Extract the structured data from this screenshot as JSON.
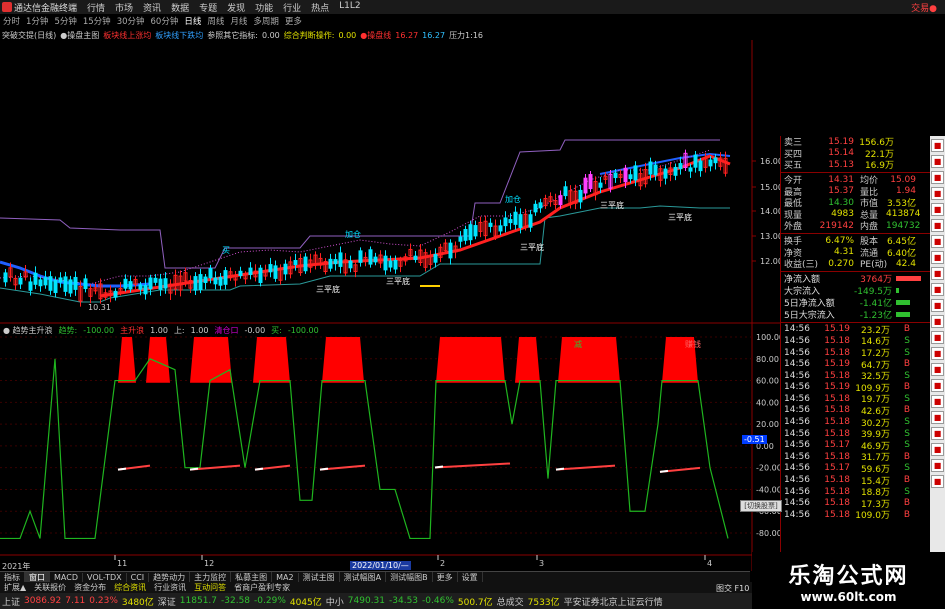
{
  "title_bar": {
    "app_name": "通达信金融终端",
    "menu": [
      "行情",
      "市场",
      "资讯",
      "数据",
      "专题",
      "发现",
      "功能",
      "行业",
      "热点",
      "L1L2"
    ],
    "trade_button": "交易●"
  },
  "period_bar": {
    "items": [
      "分时",
      "1分钟",
      "5分钟",
      "15分钟",
      "30分钟",
      "60分钟",
      "日线",
      "周线",
      "月线",
      "多周期",
      "更多"
    ],
    "active": "日线"
  },
  "indicator_bar": {
    "items": [
      {
        "text": "突破交提(日线)",
        "color": "#cccccc"
      },
      {
        "text": "●操盘主图",
        "color": "#cccccc"
      },
      {
        "text": "板块线上涨均",
        "color": "#ff3030"
      },
      {
        "text": "板块线下跌均",
        "color": "#30a0ff"
      },
      {
        "text": "参照其它指标:",
        "color": "#cccccc"
      },
      {
        "text": "0.00",
        "color": "#cccccc"
      },
      {
        "text": "综合判断操作:",
        "color": "#e0e000"
      },
      {
        "text": "0.00",
        "color": "#e0e000"
      },
      {
        "text": "●操盘线",
        "color": "#ff3030"
      },
      {
        "text": "16.27",
        "color": "#ff3030"
      },
      {
        "text": "16.27",
        "color": "#30c0ff"
      },
      {
        "text": "压力1:16",
        "color": "#cccccc"
      }
    ]
  },
  "lower_legend": {
    "items": [
      {
        "text": "● 趋势主升浪",
        "color": "#cccccc"
      },
      {
        "text": "趋势:",
        "color": "#30c030"
      },
      {
        "text": "-100.00",
        "color": "#30c030"
      },
      {
        "text": "主升浪",
        "color": "#ff3030"
      },
      {
        "text": "1.00",
        "color": "#cccccc"
      },
      {
        "text": "上:",
        "color": "#cccccc"
      },
      {
        "text": "1.00",
        "color": "#cccccc"
      },
      {
        "text": "清仓口",
        "color": "#cc00cc"
      },
      {
        "text": "-0.00",
        "color": "#cccccc"
      },
      {
        "text": "买:",
        "color": "#30c030"
      },
      {
        "text": "-100.00",
        "color": "#30c030"
      }
    ]
  },
  "quote_panel": {
    "levels": [
      {
        "label": "卖三",
        "price": "15.19",
        "vol": "156.6万",
        "flag": ""
      },
      {
        "label": "买四",
        "price": "15.14",
        "vol": "22.1万",
        "flag": ""
      },
      {
        "label": "买五",
        "price": "15.13",
        "vol": "16.9万",
        "flag": ""
      }
    ],
    "stats": [
      {
        "l1": "今开",
        "v1": "14.31",
        "l2": "均价",
        "v2": "15.09",
        "c1": "#ff4040",
        "c2": "#ff4040"
      },
      {
        "l1": "最高",
        "v1": "15.37",
        "l2": "量比",
        "v2": "1.94",
        "c1": "#ff4040",
        "c2": "#ff4040"
      },
      {
        "l1": "最低",
        "v1": "14.30",
        "l2": "市值",
        "v2": "3.53亿",
        "c1": "#30c030",
        "c2": "#e0e000"
      },
      {
        "l1": "现量",
        "v1": "4983",
        "l2": "总量",
        "v2": "413874",
        "c1": "#e0e000",
        "c2": "#e0e000"
      },
      {
        "l1": "外盘",
        "v1": "219142",
        "l2": "内盘",
        "v2": "194732",
        "c1": "#ff4040",
        "c2": "#30c030"
      }
    ],
    "stats2": [
      {
        "l1": "换手",
        "v1": "6.47%",
        "l2": "股本",
        "v2": "6.45亿",
        "c1": "#e0e000",
        "c2": "#e0e000"
      },
      {
        "l1": "净资",
        "v1": "4.31",
        "l2": "流通",
        "v2": "6.40亿",
        "c1": "#e0e000",
        "c2": "#e0e000"
      },
      {
        "l1": "收益(三)",
        "v1": "0.270",
        "l2": "PE(动)",
        "v2": "42.4",
        "c1": "#e0e000",
        "c2": "#e0e000"
      }
    ],
    "flows": [
      {
        "label": "净流入额",
        "value": "3764万",
        "color": "#ff4040",
        "bar": 0.9
      },
      {
        "label": "大宗流入",
        "value": "-149.5万",
        "color": "#30c030",
        "bar": 0.1
      },
      {
        "label": "5日净流入额",
        "value": "-1.41亿",
        "color": "#30c030",
        "bar": 0.5
      },
      {
        "label": "5日大宗流入",
        "value": "-1.23亿",
        "color": "#30c030",
        "bar": 0.5
      }
    ],
    "ticks": [
      {
        "t": "14:56",
        "p": "15.19",
        "v": "23.2万",
        "s": "B"
      },
      {
        "t": "14:56",
        "p": "15.18",
        "v": "14.6万",
        "s": "S"
      },
      {
        "t": "14:56",
        "p": "15.18",
        "v": "17.2万",
        "s": "S"
      },
      {
        "t": "14:56",
        "p": "15.19",
        "v": "64.7万",
        "s": "B"
      },
      {
        "t": "14:56",
        "p": "15.18",
        "v": "32.5万",
        "s": "S"
      },
      {
        "t": "14:56",
        "p": "15.19",
        "v": "109.9万",
        "s": "B"
      },
      {
        "t": "14:56",
        "p": "15.18",
        "v": "19.7万",
        "s": "S"
      },
      {
        "t": "14:56",
        "p": "15.18",
        "v": "42.6万",
        "s": "B"
      },
      {
        "t": "14:56",
        "p": "15.18",
        "v": "30.2万",
        "s": "S"
      },
      {
        "t": "14:56",
        "p": "15.18",
        "v": "39.9万",
        "s": "S"
      },
      {
        "t": "14:56",
        "p": "15.17",
        "v": "46.9万",
        "s": "S"
      },
      {
        "t": "14:56",
        "p": "15.18",
        "v": "31.7万",
        "s": "B"
      },
      {
        "t": "14:56",
        "p": "15.17",
        "v": "59.6万",
        "s": "S"
      },
      {
        "t": "14:56",
        "p": "15.18",
        "v": "15.4万",
        "s": "B"
      },
      {
        "t": "14:56",
        "p": "15.18",
        "v": "18.8万",
        "s": "S"
      },
      {
        "t": "14:56",
        "p": "15.18",
        "v": "17.3万",
        "s": "B"
      },
      {
        "t": "14:56",
        "p": "15.18",
        "v": "109.0万",
        "s": "B"
      }
    ]
  },
  "chart_text": {
    "main_y": [
      "16.00",
      "15.00",
      "14.00",
      "13.00",
      "12.00"
    ],
    "lower_y": [
      "100.00",
      "80.00",
      "60.00",
      "40.00",
      "20.00",
      "0.00",
      "-20.00",
      "-40.00",
      "-60.00",
      "-80.00"
    ],
    "annotations": [
      {
        "text": "三平底",
        "x": 316,
        "y": 284
      },
      {
        "text": "三平底",
        "x": 386,
        "y": 276
      },
      {
        "text": "三平底",
        "x": 520,
        "y": 242
      },
      {
        "text": "三平底",
        "x": 600,
        "y": 200
      },
      {
        "text": "三平底",
        "x": 668,
        "y": 212
      }
    ],
    "buy_marks": [
      {
        "text": "买",
        "x": 222,
        "y": 245
      },
      {
        "text": "加仓",
        "x": 345,
        "y": 229
      },
      {
        "text": "加仓",
        "x": 505,
        "y": 194
      }
    ],
    "low_label": "10.31",
    "lower_top_marks": [
      {
        "text": "减",
        "x": 574,
        "y": 340,
        "color": "#30c030"
      },
      {
        "text": "赚钱",
        "x": 685,
        "y": 340,
        "color": "#ff6060"
      }
    ],
    "year_label": "2021年",
    "date_label": "2022/01/10/—",
    "x_ticks": [
      {
        "text": "11",
        "x": 115
      },
      {
        "text": "12",
        "x": 202
      },
      {
        "text": "2",
        "x": 438
      },
      {
        "text": "3",
        "x": 537
      },
      {
        "text": "4",
        "x": 705
      }
    ],
    "value_box": "-0.51",
    "popup": "[切换股票]"
  },
  "tabs_bar": {
    "items": [
      "指标",
      "窗口",
      "MACD",
      "VOL-TDX",
      "CCI",
      "趋势动力",
      "主力监控",
      "私募主图",
      "MA2",
      "测试主图",
      "测试幅图A",
      "测试幅图B",
      "更多",
      "设置"
    ]
  },
  "tabs2_bar": {
    "items": [
      {
        "text": "扩展▲",
        "hl": false
      },
      {
        "text": "关联报价",
        "hl": false
      },
      {
        "text": "资金分布",
        "hl": false
      },
      {
        "text": "综合资讯",
        "hl": true
      },
      {
        "text": "行业资讯",
        "hl": false
      },
      {
        "text": "互动问答",
        "hl": true
      },
      {
        "text": "省商户盈利专家",
        "hl": false
      }
    ]
  },
  "view_mode": "图交 F10 模版",
  "status_bar": {
    "items": [
      {
        "text": "上证",
        "color": "#cccccc"
      },
      {
        "text": "3086.92",
        "color": "#ff4040"
      },
      {
        "text": "7.11",
        "color": "#ff4040"
      },
      {
        "text": "0.23%",
        "color": "#ff4040"
      },
      {
        "text": "3480亿",
        "color": "#e0e000"
      },
      {
        "text": "深证",
        "color": "#cccccc"
      },
      {
        "text": "11851.7",
        "color": "#30c030"
      },
      {
        "text": "-32.58",
        "color": "#30c030"
      },
      {
        "text": "-0.29%",
        "color": "#30c030"
      },
      {
        "text": "4045亿",
        "color": "#e0e000"
      },
      {
        "text": "中小",
        "color": "#cccccc"
      },
      {
        "text": "7490.31",
        "color": "#30c030"
      },
      {
        "text": "-34.53",
        "color": "#30c030"
      },
      {
        "text": "-0.46%",
        "color": "#30c030"
      },
      {
        "text": "500.7亿",
        "color": "#e0e000"
      },
      {
        "text": "总成交",
        "color": "#cccccc"
      },
      {
        "text": "7533亿",
        "color": "#e0e000"
      },
      {
        "text": "平安证券北京上证云行情",
        "color": "#cccccc"
      }
    ]
  },
  "watermark": {
    "title": "乐淘公式网",
    "url": "www.60lt.com"
  },
  "colors": {
    "up": "#ff4040",
    "down": "#30c030",
    "candle_up": "#00e5ff",
    "candle_magenta": "#ff40ff",
    "ma_red": "#ff2020",
    "ma_blue": "#2060ff",
    "env_purple": "#9060c0",
    "env_teal": "#2a9a9a",
    "area_red": "#ff0000",
    "line_green": "#1fb51f",
    "grid_red": "#8a0000"
  }
}
